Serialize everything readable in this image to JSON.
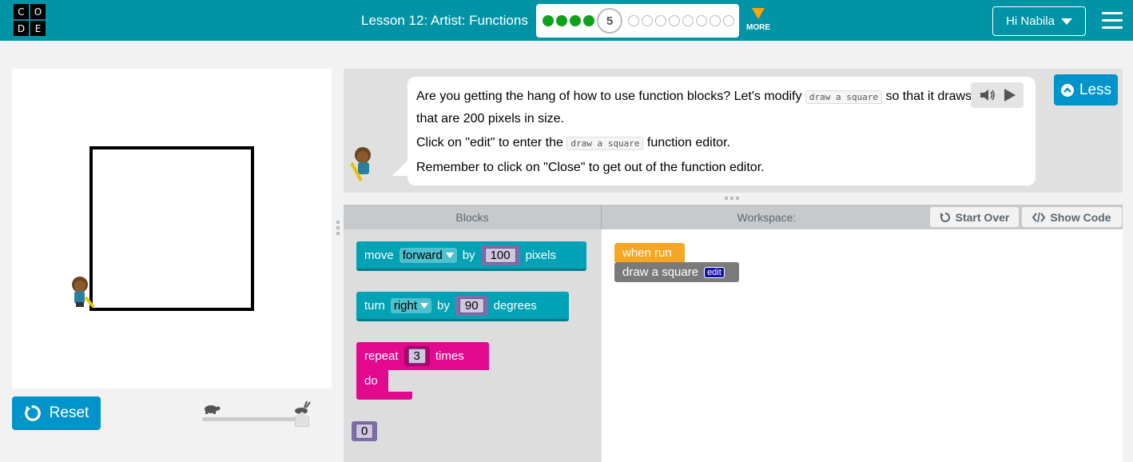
{
  "header": {
    "logo_letters": [
      "C",
      "O",
      "D",
      "E"
    ],
    "lesson_title": "Lesson 12: Artist: Functions",
    "current_level": "5",
    "levels_completed": 4,
    "levels_remaining": 8,
    "more_label": "MORE",
    "user_greeting": "Hi Nabila",
    "colors": {
      "bar": "#0094a6",
      "done": "#0ea11b",
      "more": "#ffa400"
    }
  },
  "visualization": {
    "reset_label": "Reset"
  },
  "instructions": {
    "line1_before": "Are you getting the hang of how to use function blocks? Let's modify ",
    "line1_code": "draw a square",
    "line1_after": " so that it draws squares that are 200 pixels in size.",
    "line2_before": "Click on \"edit\" to enter the ",
    "line2_code": "draw a square",
    "line2_after": " function editor.",
    "line3": "Remember to click on \"Close\" to get out of the function editor.",
    "less_label": "Less"
  },
  "workspace_header": {
    "blocks_title": "Blocks",
    "workspace_title": "Workspace:",
    "start_over_label": "Start Over",
    "show_code_label": "Show Code"
  },
  "toolbox": {
    "move": {
      "prefix": "move",
      "direction": "forward",
      "by": "by",
      "value": "100",
      "suffix": "pixels"
    },
    "turn": {
      "prefix": "turn",
      "direction": "right",
      "by": "by",
      "value": "90",
      "suffix": "degrees"
    },
    "repeat": {
      "prefix": "repeat",
      "value": "3",
      "suffix": "times",
      "do": "do"
    },
    "number": "0"
  },
  "workspace": {
    "when_run": "when run",
    "call": "draw a square",
    "edit": "edit"
  }
}
